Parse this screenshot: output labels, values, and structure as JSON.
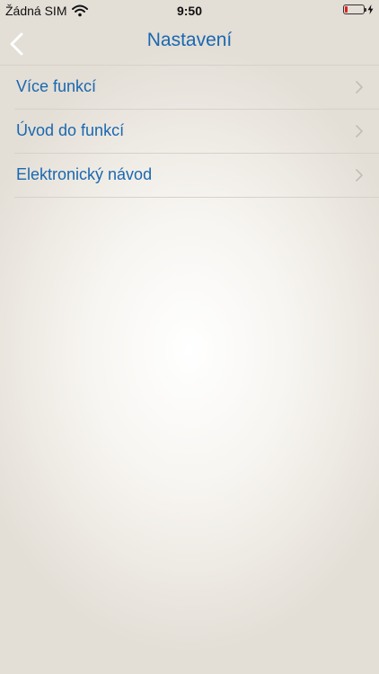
{
  "status_bar": {
    "carrier": "Žádná SIM",
    "time": "9:50",
    "battery_level": 0.15,
    "battery_color": "#e02020"
  },
  "nav": {
    "title": "Nastavení",
    "back_icon": "chevron-left-icon",
    "accent_color": "#1a68b0"
  },
  "menu": {
    "items": [
      {
        "label": "Více funkcí"
      },
      {
        "label": "Úvod do funkcí"
      },
      {
        "label": "Elektronický návod"
      }
    ]
  }
}
